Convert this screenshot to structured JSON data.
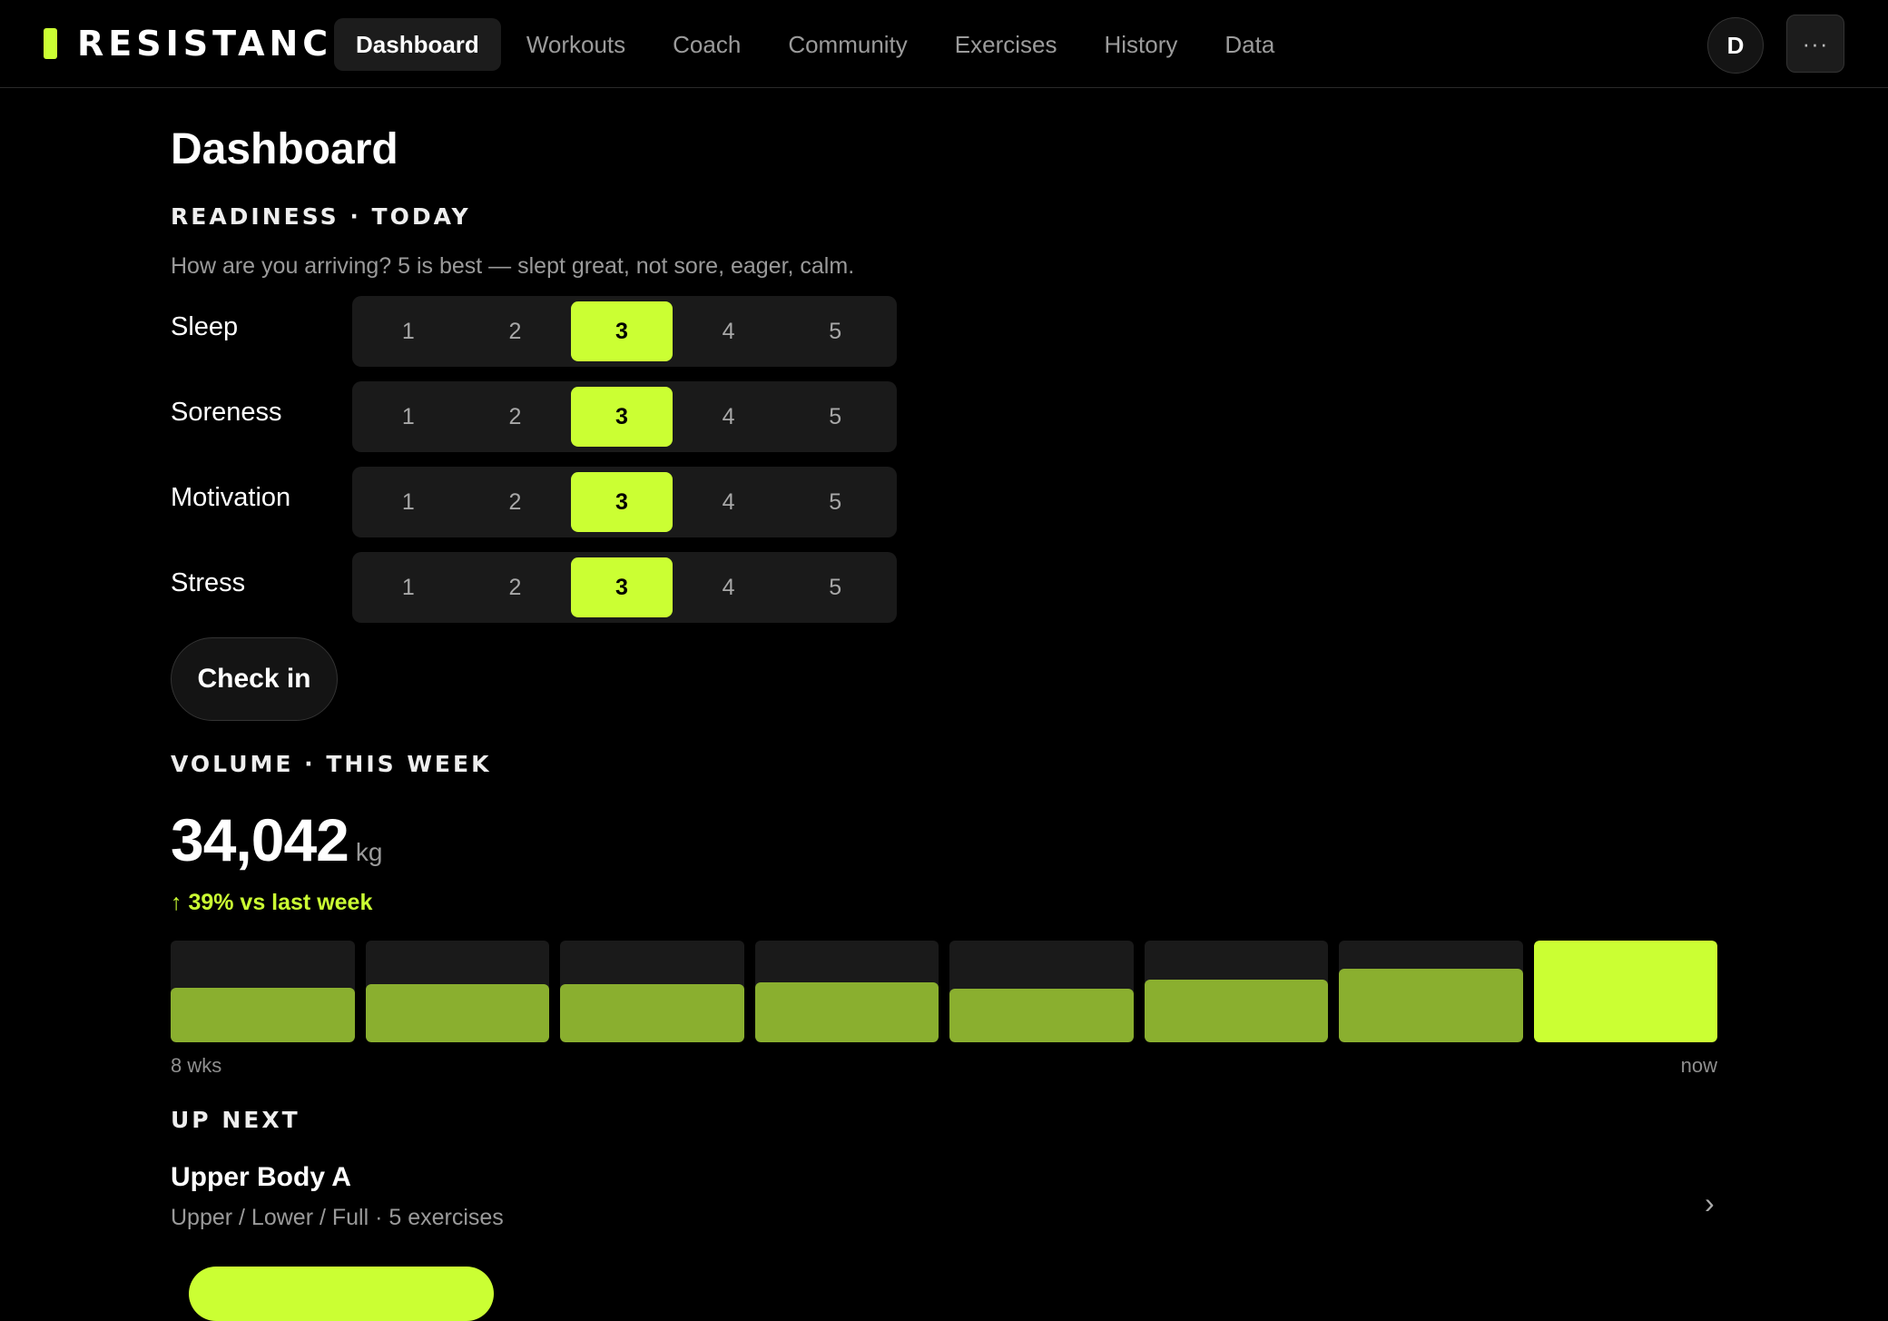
{
  "brand": {
    "name": "RESISTANCE"
  },
  "nav": {
    "tabs": [
      "Dashboard",
      "Workouts",
      "Coach",
      "Community",
      "Exercises",
      "History",
      "Data"
    ],
    "active": "Dashboard"
  },
  "user": {
    "avatar_initial": "D",
    "more_label": "···"
  },
  "page": {
    "title": "Dashboard"
  },
  "readiness": {
    "section_label": "READINESS · TODAY",
    "hint": "How are you arriving? 5 is best — slept great, not sore, eager, calm.",
    "scale": [
      "1",
      "2",
      "3",
      "4",
      "5"
    ],
    "rows": [
      {
        "label": "Sleep",
        "selected": "3"
      },
      {
        "label": "Soreness",
        "selected": "3"
      },
      {
        "label": "Motivation",
        "selected": "3"
      },
      {
        "label": "Stress",
        "selected": "3"
      }
    ],
    "checkin_label": "Check in"
  },
  "volume": {
    "section_label": "VOLUME · THIS WEEK",
    "value": "34,042",
    "unit": "kg",
    "delta": "↑ 39% vs last week",
    "weekly_fractions": [
      0.54,
      0.57,
      0.57,
      0.59,
      0.53,
      0.62,
      0.72,
      1.0
    ],
    "caption_start": "8 wks",
    "caption_end": "now",
    "colors": {
      "past": "#8aaf2f",
      "current": "#cbff33",
      "track": "#1a1a1a"
    }
  },
  "up_next": {
    "section_label": "UP NEXT",
    "title": "Upper Body A",
    "meta": "Upper / Lower / Full · 5 exercises",
    "chevron": "›"
  },
  "colors": {
    "accent": "#cbff33",
    "background": "#000000"
  }
}
